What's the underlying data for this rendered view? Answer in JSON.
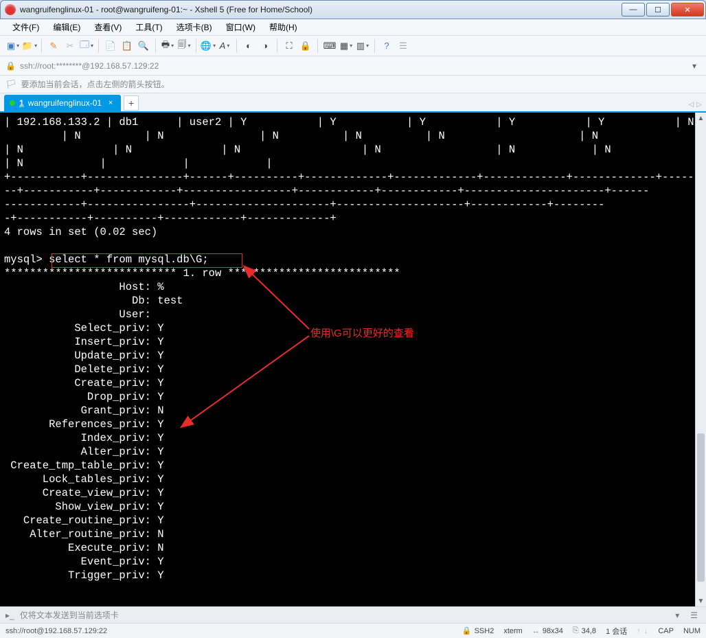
{
  "window": {
    "title": "wangruifenglinux-01 - root@wangruifeng-01:~ - Xshell 5 (Free for Home/School)"
  },
  "menu": {
    "file": "文件(F)",
    "edit": "编辑(E)",
    "view": "查看(V)",
    "tools": "工具(T)",
    "tab": "选项卡(B)",
    "window": "窗口(W)",
    "help": "帮助(H)"
  },
  "address": {
    "text": "ssh://root:********@192.168.57.129:22"
  },
  "hint": {
    "text": "要添加当前会话，点击左侧的箭头按钮。"
  },
  "tab": {
    "index": "1",
    "label": "wangruifenglinux-01"
  },
  "terminal": {
    "pre_lines": "| 192.168.133.2 | db1      | user2 | Y           | Y           | Y           | Y           | Y           | N\n         | N          | N               | N          | N          | N                     | N\n| N              | N              | N                   | N                  | N            | N\n| N            |            |            |\n+-----------+---------------+------+----------+-------------+-------------+-------------+-------------+-----------\n--+-----------+------------+-----------------+------------+------------+----------------------+------\n------------+----------------+---------------------+--------------------+------------+--------\n-+-----------+----------+------------+-------------+\n4 rows in set (0.02 sec)\n",
    "prompt": "mysql>",
    "command": "select * from mysql.db\\G;",
    "row_header": "*************************** 1. row ***************************",
    "fields": [
      [
        "Host",
        "%"
      ],
      [
        "Db",
        "test"
      ],
      [
        "User",
        ""
      ],
      [
        "Select_priv",
        "Y"
      ],
      [
        "Insert_priv",
        "Y"
      ],
      [
        "Update_priv",
        "Y"
      ],
      [
        "Delete_priv",
        "Y"
      ],
      [
        "Create_priv",
        "Y"
      ],
      [
        "Drop_priv",
        "Y"
      ],
      [
        "Grant_priv",
        "N"
      ],
      [
        "References_priv",
        "Y"
      ],
      [
        "Index_priv",
        "Y"
      ],
      [
        "Alter_priv",
        "Y"
      ],
      [
        "Create_tmp_table_priv",
        "Y"
      ],
      [
        "Lock_tables_priv",
        "Y"
      ],
      [
        "Create_view_priv",
        "Y"
      ],
      [
        "Show_view_priv",
        "Y"
      ],
      [
        "Create_routine_priv",
        "Y"
      ],
      [
        "Alter_routine_priv",
        "N"
      ],
      [
        "Execute_priv",
        "N"
      ],
      [
        "Event_priv",
        "Y"
      ],
      [
        "Trigger_priv",
        "Y"
      ]
    ]
  },
  "annotation": {
    "text": "使用\\G可以更好的查看"
  },
  "sendbar": {
    "text": "仅将文本发送到当前选项卡"
  },
  "status": {
    "conn": "ssh://root@192.168.57.129:22",
    "ssh": "SSH2",
    "term": "xterm",
    "size": "98x34",
    "cursor": "34,8",
    "sessions": "1 会话",
    "caps": "CAP",
    "num": "NUM"
  }
}
